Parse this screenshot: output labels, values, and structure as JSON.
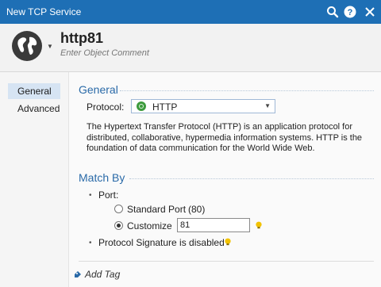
{
  "window": {
    "title": "New TCP Service"
  },
  "header": {
    "object_name": "http81",
    "comment_placeholder": "Enter Object Comment"
  },
  "sidebar": {
    "items": [
      {
        "label": "General",
        "active": true
      },
      {
        "label": "Advanced",
        "active": false
      }
    ]
  },
  "general": {
    "section_title": "General",
    "protocol_label": "Protocol:",
    "protocol_value": "HTTP",
    "description": "The Hypertext Transfer Protocol (HTTP) is an application protocol for distributed, collaborative, hypermedia information systems. HTTP is the foundation of data communication for the World Wide Web."
  },
  "match_by": {
    "section_title": "Match By",
    "port_label": "Port:",
    "standard_port_label": "Standard Port",
    "standard_port_value": "(80)",
    "customize_label": "Customize",
    "customize_value": "81",
    "signature_text": "Protocol Signature is disabled"
  },
  "add_tag_label": "Add Tag",
  "colors": {
    "titlebar": "#1e6fb5",
    "accent": "#2a6aa8",
    "bulb": "#f2c200"
  }
}
